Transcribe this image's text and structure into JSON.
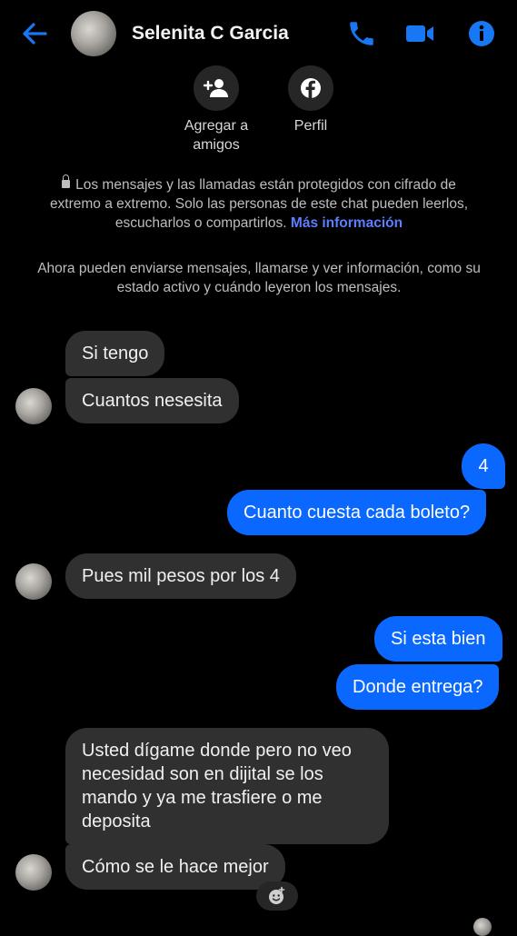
{
  "header": {
    "contact_name": "Selenita C Garcia"
  },
  "actions": {
    "add_friend_label": "Agregar a amigos",
    "profile_label": "Perfil"
  },
  "notices": {
    "encryption_text": "Los mensajes y las llamadas están protegidos con cifrado de extremo a extremo. Solo las personas de este chat pueden leerlos, escucharlos o compartirlos.",
    "more_info_link": "Más información",
    "status_text": "Ahora pueden enviarse mensajes, llamarse y ver información, como su estado activo y cuándo leyeron los mensajes."
  },
  "messages": [
    {
      "from": "them",
      "text": "Si tengo"
    },
    {
      "from": "them",
      "text": "Cuantos nesesita"
    },
    {
      "from": "me",
      "text": "4"
    },
    {
      "from": "me",
      "text": "Cuanto cuesta cada boleto?"
    },
    {
      "from": "them",
      "text": "Pues mil pesos por los 4"
    },
    {
      "from": "me",
      "text": "Si esta bien"
    },
    {
      "from": "me",
      "text": "Donde entrega?"
    },
    {
      "from": "them",
      "text": "Usted dígame donde pero no veo necesidad son en dijital se los mando y ya me trasfiere o me deposita"
    },
    {
      "from": "them",
      "text": "Cómo se le hace mejor"
    }
  ],
  "icons": {
    "back": "arrow-left-icon",
    "call": "phone-icon",
    "video": "video-camera-icon",
    "info": "info-icon",
    "add_friend": "add-person-icon",
    "profile": "facebook-icon",
    "reaction": "add-reaction-icon"
  },
  "colors": {
    "accent": "#0a68ff",
    "incoming_bubble": "#303030",
    "background": "#000000",
    "link": "#5b7fff"
  }
}
